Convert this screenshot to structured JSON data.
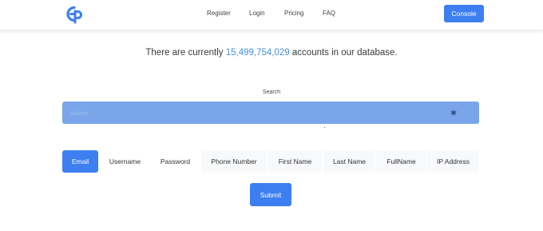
{
  "colors": {
    "accent": "#3d7ff0",
    "search_bar": "#7aa5ea",
    "count_text": "#4a90d9"
  },
  "header": {
    "logo_icon": "gp-logo-icon",
    "nav": [
      {
        "label": "Register"
      },
      {
        "label": "Login"
      },
      {
        "label": "Pricing"
      },
      {
        "label": "FAQ"
      }
    ],
    "console_label": "Console"
  },
  "headline": {
    "prefix": "There are currently ",
    "count": "15,499,754,029",
    "suffix": " accounts in our database."
  },
  "search": {
    "label": "Search",
    "placeholder": "Search",
    "icon": "asterisk-icon"
  },
  "tabs": [
    {
      "label": "Email",
      "active": true
    },
    {
      "label": "Username"
    },
    {
      "label": "Password"
    },
    {
      "label": "Phone Number"
    },
    {
      "label": "First Name"
    },
    {
      "label": "Last Name"
    },
    {
      "label": "FullName"
    },
    {
      "label": "IP Address"
    }
  ],
  "submit_label": "Submit"
}
